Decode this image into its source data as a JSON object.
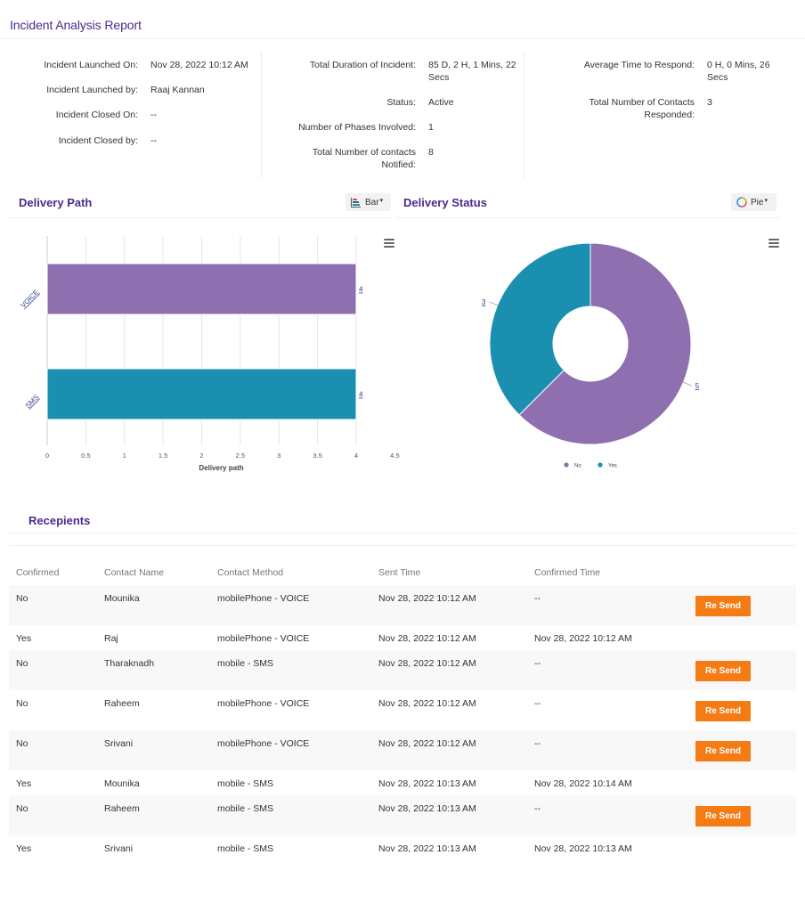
{
  "header": {
    "title": "Incident Analysis Report"
  },
  "summary": {
    "col1": [
      {
        "label": "Incident Launched On:",
        "value": "Nov 28, 2022 10:12 AM"
      },
      {
        "label": "Incident Launched by:",
        "value": "Raaj Kannan"
      },
      {
        "label": "Incident Closed On:",
        "value": "--"
      },
      {
        "label": "Incident Closed by:",
        "value": "--"
      }
    ],
    "col2": [
      {
        "label": "Total Duration of Incident:",
        "value_line1": "85 D, 2 H, 1 Mins, 22",
        "value_line2": "Secs"
      },
      {
        "label": "Status:",
        "value": "Active"
      },
      {
        "label": "Number of Phases Involved:",
        "value": "1"
      },
      {
        "label_line1": "Total Number of contacts",
        "label_line2": "Notified:",
        "value": "8"
      }
    ],
    "col3": [
      {
        "label": "Average Time to Respond:",
        "value_line1": "0 H, 0 Mins, 26",
        "value_line2": "Secs"
      },
      {
        "label_line1": "Total Number of Contacts",
        "label_line2": "Responded:",
        "value": "3"
      }
    ]
  },
  "delivery_path": {
    "title": "Delivery Path",
    "chart_type_button": {
      "label": "Bar",
      "icon": "bar-chart-icon"
    },
    "menu_icon": "hamburger-menu-icon"
  },
  "delivery_status": {
    "title": "Delivery Status",
    "chart_type_button": {
      "label": "Pie",
      "icon": "donut-chart-icon"
    },
    "menu_icon": "hamburger-menu-icon"
  },
  "chart_data": [
    {
      "type": "bar",
      "orientation": "horizontal",
      "title": "",
      "categories": [
        "VOICE",
        "SMS"
      ],
      "values": [
        4,
        4
      ],
      "colors": [
        "#8e70b0",
        "#1a8fb0"
      ],
      "data_labels": [
        "4",
        "4"
      ],
      "xlabel": "Delivery path",
      "ylabel": "",
      "xlim": [
        0,
        4.5
      ],
      "x_ticks": [
        "0",
        "0.5",
        "1",
        "1.5",
        "2",
        "2.5",
        "3",
        "3.5",
        "4",
        "4.5"
      ],
      "grid": true,
      "legend": "none"
    },
    {
      "type": "pie",
      "donut": true,
      "title": "",
      "categories": [
        "No",
        "Yes"
      ],
      "values": [
        5,
        3
      ],
      "colors": [
        "#8e70b0",
        "#1a8fb0"
      ],
      "data_labels": [
        "5",
        "3"
      ],
      "legend": "bottom-center"
    }
  ],
  "recipients": {
    "title": "Recepients",
    "columns": [
      "Confirmed",
      "Contact Name",
      "Contact Method",
      "Sent Time",
      "Confirmed Time",
      ""
    ],
    "resend_label": "Re Send",
    "rows": [
      {
        "confirmed": "No",
        "name": "Mounika",
        "method": "mobilePhone - VOICE",
        "sent": "Nov 28, 2022 10:12 AM",
        "confirmed_time": "--",
        "resend": true
      },
      {
        "confirmed": "Yes",
        "name": "Raj",
        "method": "mobilePhone - VOICE",
        "sent": "Nov 28, 2022 10:12 AM",
        "confirmed_time": "Nov 28, 2022 10:12 AM",
        "resend": false
      },
      {
        "confirmed": "No",
        "name": "Tharaknadh",
        "method": "mobile - SMS",
        "sent": "Nov 28, 2022 10:12 AM",
        "confirmed_time": "--",
        "resend": true
      },
      {
        "confirmed": "No",
        "name": "Raheem",
        "method": "mobilePhone - VOICE",
        "sent": "Nov 28, 2022 10:12 AM",
        "confirmed_time": "--",
        "resend": true
      },
      {
        "confirmed": "No",
        "name": "Srivani",
        "method": "mobilePhone - VOICE",
        "sent": "Nov 28, 2022 10:12 AM",
        "confirmed_time": "--",
        "resend": true
      },
      {
        "confirmed": "Yes",
        "name": "Mounika",
        "method": "mobile - SMS",
        "sent": "Nov 28, 2022 10:13 AM",
        "confirmed_time": "Nov 28, 2022 10:14 AM",
        "resend": false
      },
      {
        "confirmed": "No",
        "name": "Raheem",
        "method": "mobile - SMS",
        "sent": "Nov 28, 2022 10:13 AM",
        "confirmed_time": "--",
        "resend": true
      },
      {
        "confirmed": "Yes",
        "name": "Srivani",
        "method": "mobile - SMS",
        "sent": "Nov 28, 2022 10:13 AM",
        "confirmed_time": "Nov 28, 2022 10:13 AM",
        "resend": false
      }
    ]
  },
  "colors": {
    "title_purple": "#4a2b8c",
    "resend_orange": "#f57c14",
    "bar_purple": "#8e70b0",
    "bar_teal": "#1a8fb0"
  }
}
